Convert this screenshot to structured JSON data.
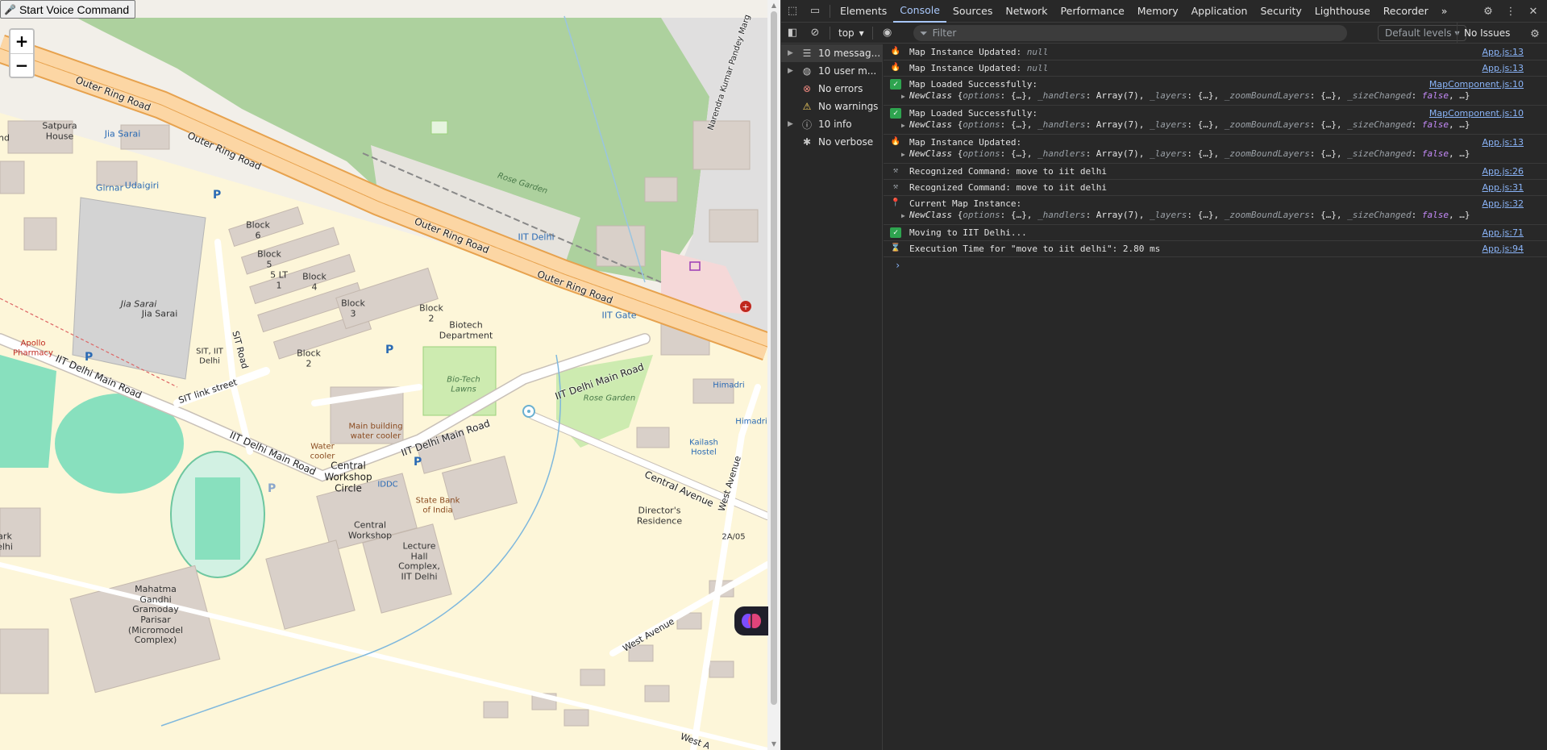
{
  "voice_button": {
    "icon": "microphone-icon",
    "label": "Start Voice Command"
  },
  "zoom": {
    "in": "+",
    "out": "−"
  },
  "map": {
    "colors": {
      "background": "#f2efe9",
      "park": "#cfe6c0",
      "green_dense": "#add19e",
      "pitch": "#88e0be",
      "trunk_road": "#fcd6a4",
      "road_outline": "#e7a24e",
      "building": "#d9d0c9"
    },
    "labels": {
      "outer_ring_road_1": "Outer Ring Road",
      "outer_ring_road_2": "Outer Ring Road",
      "outer_ring_road_3": "Outer Ring Road",
      "outer_ring_road_4": "Outer Ring Road",
      "narendra": "Narendra Kumar Pandey Marg",
      "satpura": "Satpura\nHouse",
      "jia_sarai_stop": "Jia Sarai",
      "girnar": "Girnar",
      "udaigiri": "Udaigiri",
      "block6": "Block\n6",
      "block5": "Block\n5",
      "block5lt": "5 LT\n1",
      "block4": "Block\n4",
      "block3": "Block\n3",
      "block2a": "Block\n2",
      "block2b": "Block\n2",
      "biotech": "Biotech\nDepartment",
      "biotech_lawns": "Bio-Tech\nLawns",
      "iit_delhi": "IIT Delhi",
      "iit_gate": "IIT Gate",
      "rose_garden_1": "Rose Garden",
      "rose_garden_2": "Rose Garden",
      "jia_sarai_1": "Jia Sarai",
      "jia_sarai_2": "Jia Sarai",
      "apollo": "Apollo\nPharmacy",
      "sit_iit": "SIT, IIT\nDelhi",
      "sit_road": "SIT Road",
      "sit_link": "SIT link street",
      "iit_main_1": "IIT Delhi Main Road",
      "iit_main_2": "IIT Delhi Main Road",
      "iit_main_3": "IIT Delhi Main Road",
      "iit_main_4": "IIT Delhi Main Road",
      "main_building": "Main building\nwater cooler",
      "water_cooler": "Water\ncooler",
      "cwc": "Central\nWorkshop\nCircle",
      "iddc": "IDDC",
      "sbi": "State Bank\nof India",
      "central_workshop": "Central\nWorkshop",
      "lhc": "Lecture\nHall\nComplex,\nIIT Delhi",
      "mahatma": "Mahatma\nGandhi\nGramoday\nParisar\n(Micromodel\nComplex)",
      "himadri_1": "Himadri",
      "himadri_2": "Himadri",
      "kailash": "Kailash\nHostel",
      "central_ave": "Central Avenue",
      "directors": "Director's\nResidence",
      "west_ave_1": "West Avenue",
      "west_ave_2": "West Avenue",
      "west_ave_3": "West A",
      "twoa05": "2A/05",
      "park_edge": "ark\nelhi",
      "nd_edge": "nd"
    }
  },
  "devtools": {
    "tabs": [
      "Elements",
      "Console",
      "Sources",
      "Network",
      "Performance",
      "Memory",
      "Application",
      "Security",
      "Lighthouse",
      "Recorder"
    ],
    "active_tab": "Console",
    "more_tabs": "»",
    "context": "top",
    "filter_placeholder": "Filter",
    "levels": "Default levels",
    "issues": "No Issues",
    "sidebar": [
      {
        "label": "10 messag...",
        "icon": "list-icon",
        "expandable": true,
        "selected": true
      },
      {
        "label": "10 user m...",
        "icon": "user-icon",
        "expandable": true,
        "selected": false
      },
      {
        "label": "No errors",
        "icon": "error-icon",
        "expandable": false,
        "selected": false
      },
      {
        "label": "No warnings",
        "icon": "warning-icon",
        "expandable": false,
        "selected": false
      },
      {
        "label": "10 info",
        "icon": "info-icon",
        "expandable": true,
        "selected": false
      },
      {
        "label": "No verbose",
        "icon": "bug-icon",
        "expandable": false,
        "selected": false
      }
    ],
    "log": [
      {
        "icon": "fire-icon",
        "text": "Map Instance Updated: ",
        "null": "null",
        "source": "App.js:13",
        "object": null
      },
      {
        "icon": "fire-icon",
        "text": "Map Instance Updated: ",
        "null": "null",
        "source": "App.js:13",
        "object": null
      },
      {
        "icon": "check-icon",
        "text": "Map Loaded Successfully:",
        "null": "",
        "source": "MapComponent.js:10",
        "object": "NewClass"
      },
      {
        "icon": "check-icon",
        "text": "Map Loaded Successfully:",
        "null": "",
        "source": "MapComponent.js:10",
        "object": "NewClass"
      },
      {
        "icon": "fire-icon",
        "text": "Map Instance Updated:",
        "null": "",
        "source": "App.js:13",
        "object": "NewClass"
      },
      {
        "icon": "hammer-icon",
        "text": "Recognized Command: move to iit delhi",
        "null": "",
        "source": "App.js:26",
        "object": null
      },
      {
        "icon": "hammer-icon",
        "text": "Recognized Command: move to iit delhi",
        "null": "",
        "source": "App.js:31",
        "object": null
      },
      {
        "icon": "pin-icon",
        "text": "Current Map Instance:",
        "null": "",
        "source": "App.js:32",
        "object": "NewClass"
      },
      {
        "icon": "check-icon",
        "text": "Moving to IIT Delhi...",
        "null": "",
        "source": "App.js:71",
        "object": null
      },
      {
        "icon": "hourglass-icon",
        "text": "Execution Time for \"move to iit delhi\": 2.80 ms",
        "null": "",
        "source": "App.js:94",
        "object": null
      }
    ],
    "object_preview": {
      "class_name": "NewClass",
      "body_parts": [
        "{",
        "options",
        ": {…}, ",
        "_handlers",
        ": Array(7), ",
        "_layers",
        ": {…}, ",
        "_zoomBoundLayers",
        ": {…}, ",
        "_sizeChanged",
        ": ",
        "false",
        ", …}"
      ]
    },
    "prompt": "›"
  }
}
